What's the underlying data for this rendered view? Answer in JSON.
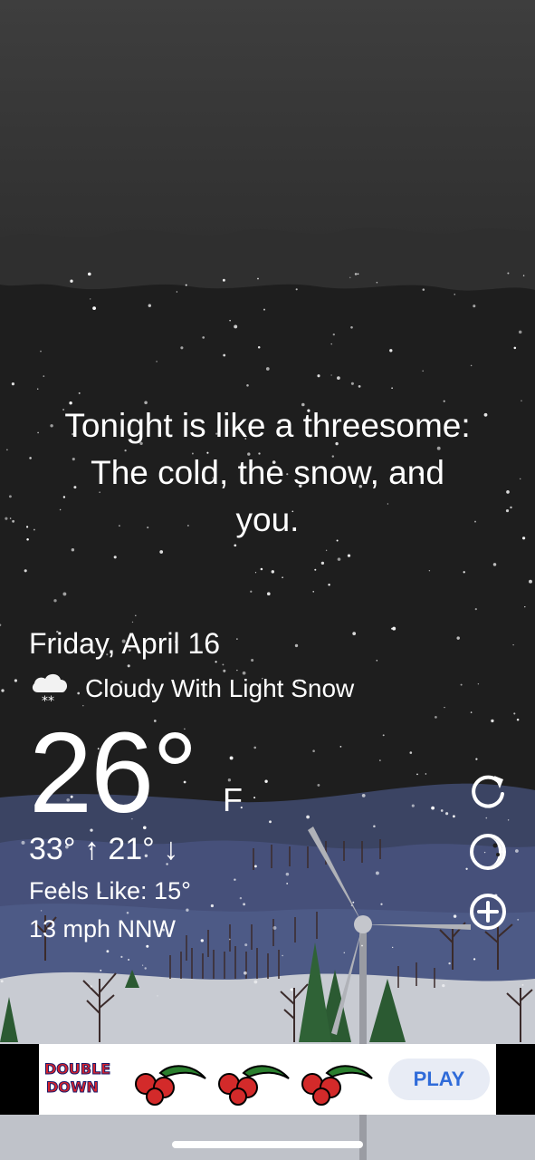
{
  "quote": {
    "line1": "Tonight is like a threesome:",
    "line2": "The cold, the snow, and",
    "line3": "you."
  },
  "weather": {
    "date": "Friday, April 16",
    "condition": "Cloudy With Light Snow",
    "condition_icon": "cloud-snow-icon",
    "temperature": "26°",
    "unit": "F",
    "high": "33°",
    "low": "21°",
    "feels_like": "Feels Like: 15°",
    "wind": "13 mph NNW"
  },
  "controls": {
    "refresh_icon": "refresh-icon",
    "moon_icon": "moon-phase-icon",
    "add_icon": "add-location-icon"
  },
  "ad": {
    "brand_line1": "DOUBLE",
    "brand_line2": "DOWN",
    "play_label": "PLAY"
  },
  "colors": {
    "sky_top": "#3d3d3d",
    "sky_night": "#1e1e1e",
    "hills": "#3f4a6a",
    "snow_ground": "#c9ccd3",
    "tree_green": "#2b5a32",
    "ad_accent": "#2f6bd9"
  }
}
